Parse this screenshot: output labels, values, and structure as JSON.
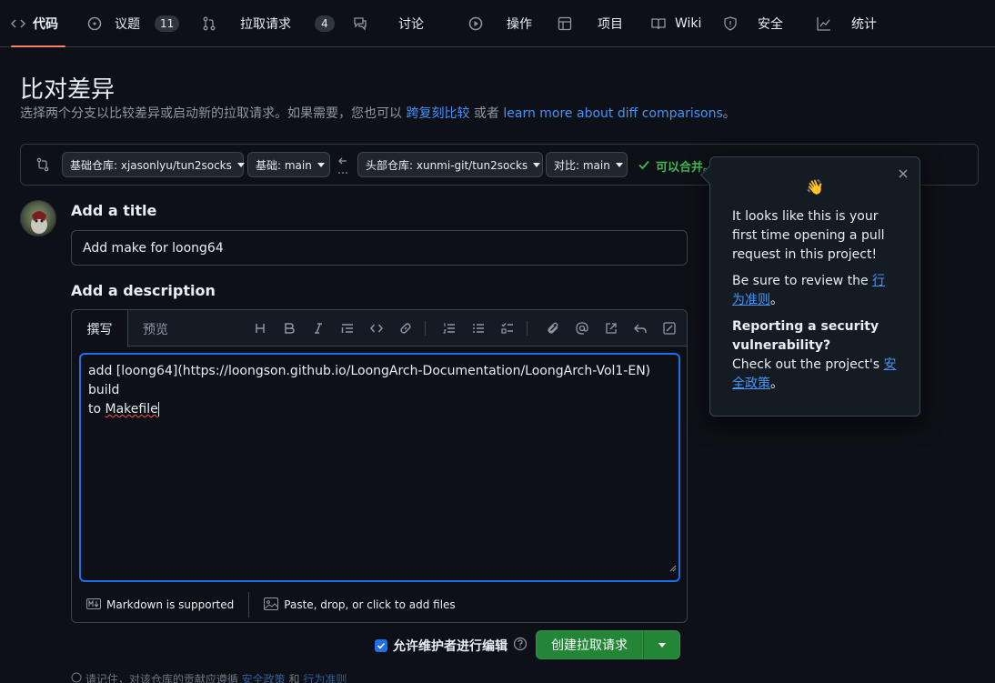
{
  "nav": {
    "code": "代码",
    "issues": "议题",
    "issues_count": "11",
    "pulls": "拉取请求",
    "pulls_count": "4",
    "discussions": "讨论",
    "actions": "操作",
    "projects": "项目",
    "wiki": "Wiki",
    "security": "安全",
    "insights": "统计"
  },
  "header": {
    "title": "比对差异",
    "subtitle": "选择两个分支以比较差异或启动新的拉取请求。如果需要，您也可以",
    "link_cross": "跨复刻比较",
    "or": "或者",
    "link_learn": "learn more about diff comparisons",
    "period": "。"
  },
  "compare": {
    "base_repo": "基础仓库: xjasonlyu/tun2socks",
    "base": "基础: main",
    "head_repo": "头部仓库: xunmi-git/tun2socks",
    "compare": "对比: main",
    "mergeable": "可以合并。"
  },
  "form": {
    "title_label": "Add a title",
    "title_value": "Add make for loong64",
    "desc_label": "Add a description",
    "tab_write": "撰写",
    "tab_preview": "预览",
    "body_line1": "add [loong64](https://loongson.github.io/LoongArch-Documentation/LoongArch-Vol1-EN) build",
    "body_line2_prefix": "to ",
    "body_line2_word": "Makefile",
    "markdown_note": "Markdown is supported",
    "attach_note": "Paste, drop, or click to add files"
  },
  "actions": {
    "allow_edits": "允许维护者进行编辑",
    "create": "创建拉取请求"
  },
  "footer_note": {
    "prefix": "请记住，对该仓库的贡献应遵循",
    "link1": "安全政策",
    "and": "和",
    "link2": "行为准则"
  },
  "popover": {
    "emoji": "👋",
    "p1": "It looks like this is your first time opening a pull request in this project!",
    "p2_prefix": "Be sure to review the ",
    "p2_link": "行为准则",
    "p2_suffix": "。",
    "p3_bold": "Reporting a security vulnerability?",
    "p3_prefix": "Check out the project's ",
    "p3_link": "安全政策",
    "p3_suffix": "。"
  },
  "colors": {
    "accent": "#1f6feb",
    "success": "#238636",
    "tab_underline": "#f78166"
  }
}
